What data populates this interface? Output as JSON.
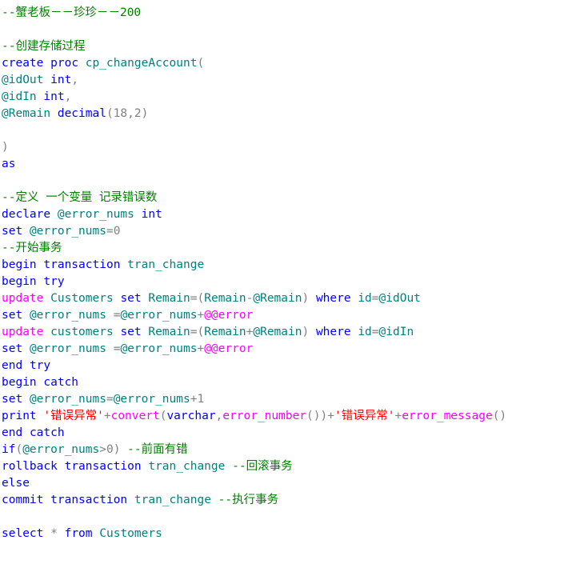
{
  "editor": {
    "background": "#ffffff",
    "language": "SQL",
    "colors": {
      "comment": "#008000",
      "keyword": "#0000ff",
      "identifier": "#008080",
      "function": "#ff00ff",
      "string": "#ff0000",
      "punctuation": "#808080",
      "plain": "#000000"
    }
  },
  "lines": [
    {
      "id": 1,
      "tokens": [
        {
          "t": "--蟹老板－－珍珍－－200",
          "c": "cmt"
        }
      ]
    },
    {
      "id": 2,
      "tokens": []
    },
    {
      "id": 3,
      "tokens": [
        {
          "t": "--创建存储过程",
          "c": "cmt"
        }
      ]
    },
    {
      "id": 4,
      "tokens": [
        {
          "t": "create",
          "c": "kw"
        },
        {
          "t": " ",
          "c": "plain"
        },
        {
          "t": "proc",
          "c": "kw"
        },
        {
          "t": " ",
          "c": "plain"
        },
        {
          "t": "cp_changeAccount",
          "c": "ident"
        },
        {
          "t": "(",
          "c": "pun"
        }
      ]
    },
    {
      "id": 5,
      "tokens": [
        {
          "t": "@idOut",
          "c": "ident"
        },
        {
          "t": " ",
          "c": "plain"
        },
        {
          "t": "int",
          "c": "kw"
        },
        {
          "t": ",",
          "c": "pun"
        }
      ]
    },
    {
      "id": 6,
      "tokens": [
        {
          "t": "@idIn",
          "c": "ident"
        },
        {
          "t": " ",
          "c": "plain"
        },
        {
          "t": "int",
          "c": "kw"
        },
        {
          "t": ",",
          "c": "pun"
        }
      ]
    },
    {
      "id": 7,
      "tokens": [
        {
          "t": "@Remain",
          "c": "ident"
        },
        {
          "t": " ",
          "c": "plain"
        },
        {
          "t": "decimal",
          "c": "kw"
        },
        {
          "t": "(18,2)",
          "c": "num"
        }
      ]
    },
    {
      "id": 8,
      "tokens": []
    },
    {
      "id": 9,
      "tokens": [
        {
          "t": ")",
          "c": "pun"
        }
      ]
    },
    {
      "id": 10,
      "tokens": [
        {
          "t": "as",
          "c": "kw"
        }
      ]
    },
    {
      "id": 11,
      "tokens": []
    },
    {
      "id": 12,
      "tokens": [
        {
          "t": "--定义 一个变量 记录错误数",
          "c": "cmt"
        }
      ]
    },
    {
      "id": 13,
      "tokens": [
        {
          "t": "declare",
          "c": "kw"
        },
        {
          "t": " ",
          "c": "plain"
        },
        {
          "t": "@error_nums",
          "c": "ident"
        },
        {
          "t": " ",
          "c": "plain"
        },
        {
          "t": "int",
          "c": "kw"
        }
      ]
    },
    {
      "id": 14,
      "tokens": [
        {
          "t": "set",
          "c": "kw"
        },
        {
          "t": " ",
          "c": "plain"
        },
        {
          "t": "@error_nums",
          "c": "ident"
        },
        {
          "t": "=",
          "c": "pun"
        },
        {
          "t": "0",
          "c": "num"
        }
      ]
    },
    {
      "id": 15,
      "tokens": [
        {
          "t": "--开始事务",
          "c": "cmt"
        }
      ]
    },
    {
      "id": 16,
      "tokens": [
        {
          "t": "begin",
          "c": "kw"
        },
        {
          "t": " ",
          "c": "plain"
        },
        {
          "t": "transaction",
          "c": "kw"
        },
        {
          "t": " ",
          "c": "plain"
        },
        {
          "t": "tran_change",
          "c": "ident"
        }
      ]
    },
    {
      "id": 17,
      "tokens": [
        {
          "t": "begin",
          "c": "kw"
        },
        {
          "t": " ",
          "c": "plain"
        },
        {
          "t": "try",
          "c": "kw"
        }
      ]
    },
    {
      "id": 18,
      "tokens": [
        {
          "t": "update",
          "c": "fn"
        },
        {
          "t": " ",
          "c": "plain"
        },
        {
          "t": "Customers",
          "c": "ident"
        },
        {
          "t": " ",
          "c": "plain"
        },
        {
          "t": "set",
          "c": "kw"
        },
        {
          "t": " ",
          "c": "plain"
        },
        {
          "t": "Remain",
          "c": "ident"
        },
        {
          "t": "=(",
          "c": "pun"
        },
        {
          "t": "Remain",
          "c": "ident"
        },
        {
          "t": "-",
          "c": "pun"
        },
        {
          "t": "@Remain",
          "c": "ident"
        },
        {
          "t": ")",
          "c": "pun"
        },
        {
          "t": " ",
          "c": "plain"
        },
        {
          "t": "where",
          "c": "kw"
        },
        {
          "t": " ",
          "c": "plain"
        },
        {
          "t": "id",
          "c": "ident"
        },
        {
          "t": "=",
          "c": "pun"
        },
        {
          "t": "@idOut",
          "c": "ident"
        }
      ]
    },
    {
      "id": 19,
      "tokens": [
        {
          "t": "set",
          "c": "kw"
        },
        {
          "t": " ",
          "c": "plain"
        },
        {
          "t": "@error_nums",
          "c": "ident"
        },
        {
          "t": " ",
          "c": "plain"
        },
        {
          "t": "=",
          "c": "pun"
        },
        {
          "t": "@error_nums",
          "c": "ident"
        },
        {
          "t": "+",
          "c": "pun"
        },
        {
          "t": "@@error",
          "c": "fn"
        }
      ]
    },
    {
      "id": 20,
      "tokens": [
        {
          "t": "update",
          "c": "fn"
        },
        {
          "t": " ",
          "c": "plain"
        },
        {
          "t": "customers",
          "c": "ident"
        },
        {
          "t": " ",
          "c": "plain"
        },
        {
          "t": "set",
          "c": "kw"
        },
        {
          "t": " ",
          "c": "plain"
        },
        {
          "t": "Remain",
          "c": "ident"
        },
        {
          "t": "=(",
          "c": "pun"
        },
        {
          "t": "Remain",
          "c": "ident"
        },
        {
          "t": "+",
          "c": "pun"
        },
        {
          "t": "@Remain",
          "c": "ident"
        },
        {
          "t": ")",
          "c": "pun"
        },
        {
          "t": " ",
          "c": "plain"
        },
        {
          "t": "where",
          "c": "kw"
        },
        {
          "t": " ",
          "c": "plain"
        },
        {
          "t": "id",
          "c": "ident"
        },
        {
          "t": "=",
          "c": "pun"
        },
        {
          "t": "@idIn",
          "c": "ident"
        }
      ]
    },
    {
      "id": 21,
      "tokens": [
        {
          "t": "set",
          "c": "kw"
        },
        {
          "t": " ",
          "c": "plain"
        },
        {
          "t": "@error_nums",
          "c": "ident"
        },
        {
          "t": " ",
          "c": "plain"
        },
        {
          "t": "=",
          "c": "pun"
        },
        {
          "t": "@error_nums",
          "c": "ident"
        },
        {
          "t": "+",
          "c": "pun"
        },
        {
          "t": "@@error",
          "c": "fn"
        }
      ]
    },
    {
      "id": 22,
      "tokens": [
        {
          "t": "end",
          "c": "kw"
        },
        {
          "t": " ",
          "c": "plain"
        },
        {
          "t": "try",
          "c": "kw"
        }
      ]
    },
    {
      "id": 23,
      "tokens": [
        {
          "t": "begin",
          "c": "kw"
        },
        {
          "t": " ",
          "c": "plain"
        },
        {
          "t": "catch",
          "c": "kw"
        }
      ]
    },
    {
      "id": 24,
      "tokens": [
        {
          "t": "set",
          "c": "kw"
        },
        {
          "t": " ",
          "c": "plain"
        },
        {
          "t": "@error_nums",
          "c": "ident"
        },
        {
          "t": "=",
          "c": "pun"
        },
        {
          "t": "@error_nums",
          "c": "ident"
        },
        {
          "t": "+",
          "c": "pun"
        },
        {
          "t": "1",
          "c": "num"
        }
      ]
    },
    {
      "id": 25,
      "tokens": [
        {
          "t": "print",
          "c": "kw"
        },
        {
          "t": " ",
          "c": "plain"
        },
        {
          "t": "'错误异常'",
          "c": "str"
        },
        {
          "t": "+",
          "c": "pun"
        },
        {
          "t": "convert",
          "c": "fn"
        },
        {
          "t": "(",
          "c": "pun"
        },
        {
          "t": "varchar",
          "c": "kw"
        },
        {
          "t": ",",
          "c": "pun"
        },
        {
          "t": "error_number",
          "c": "fn"
        },
        {
          "t": "())",
          "c": "pun"
        },
        {
          "t": "+",
          "c": "pun"
        },
        {
          "t": "'错误异常'",
          "c": "str"
        },
        {
          "t": "+",
          "c": "pun"
        },
        {
          "t": "error_message",
          "c": "fn"
        },
        {
          "t": "()",
          "c": "pun"
        }
      ]
    },
    {
      "id": 26,
      "tokens": [
        {
          "t": "end",
          "c": "kw"
        },
        {
          "t": " ",
          "c": "plain"
        },
        {
          "t": "catch",
          "c": "kw"
        }
      ]
    },
    {
      "id": 27,
      "tokens": [
        {
          "t": "if",
          "c": "kw"
        },
        {
          "t": "(",
          "c": "pun"
        },
        {
          "t": "@error_nums",
          "c": "ident"
        },
        {
          "t": ">",
          "c": "pun"
        },
        {
          "t": "0",
          "c": "num"
        },
        {
          "t": ")",
          "c": "pun"
        },
        {
          "t": " ",
          "c": "plain"
        },
        {
          "t": "--前面有错",
          "c": "cmt"
        }
      ]
    },
    {
      "id": 28,
      "tokens": [
        {
          "t": "rollback",
          "c": "kw"
        },
        {
          "t": " ",
          "c": "plain"
        },
        {
          "t": "transaction",
          "c": "kw"
        },
        {
          "t": " ",
          "c": "plain"
        },
        {
          "t": "tran_change",
          "c": "ident"
        },
        {
          "t": " ",
          "c": "plain"
        },
        {
          "t": "--回滚事务",
          "c": "cmt"
        }
      ]
    },
    {
      "id": 29,
      "tokens": [
        {
          "t": "else",
          "c": "kw"
        }
      ]
    },
    {
      "id": 30,
      "tokens": [
        {
          "t": "commit",
          "c": "kw"
        },
        {
          "t": " ",
          "c": "plain"
        },
        {
          "t": "transaction",
          "c": "kw"
        },
        {
          "t": " ",
          "c": "plain"
        },
        {
          "t": "tran_change",
          "c": "ident"
        },
        {
          "t": " ",
          "c": "plain"
        },
        {
          "t": "--执行事务",
          "c": "cmt"
        }
      ]
    },
    {
      "id": 31,
      "tokens": []
    },
    {
      "id": 32,
      "tokens": [
        {
          "t": "select",
          "c": "kw"
        },
        {
          "t": " ",
          "c": "plain"
        },
        {
          "t": "*",
          "c": "pun"
        },
        {
          "t": " ",
          "c": "plain"
        },
        {
          "t": "from",
          "c": "kw"
        },
        {
          "t": " ",
          "c": "plain"
        },
        {
          "t": "Customers",
          "c": "ident"
        }
      ]
    }
  ]
}
